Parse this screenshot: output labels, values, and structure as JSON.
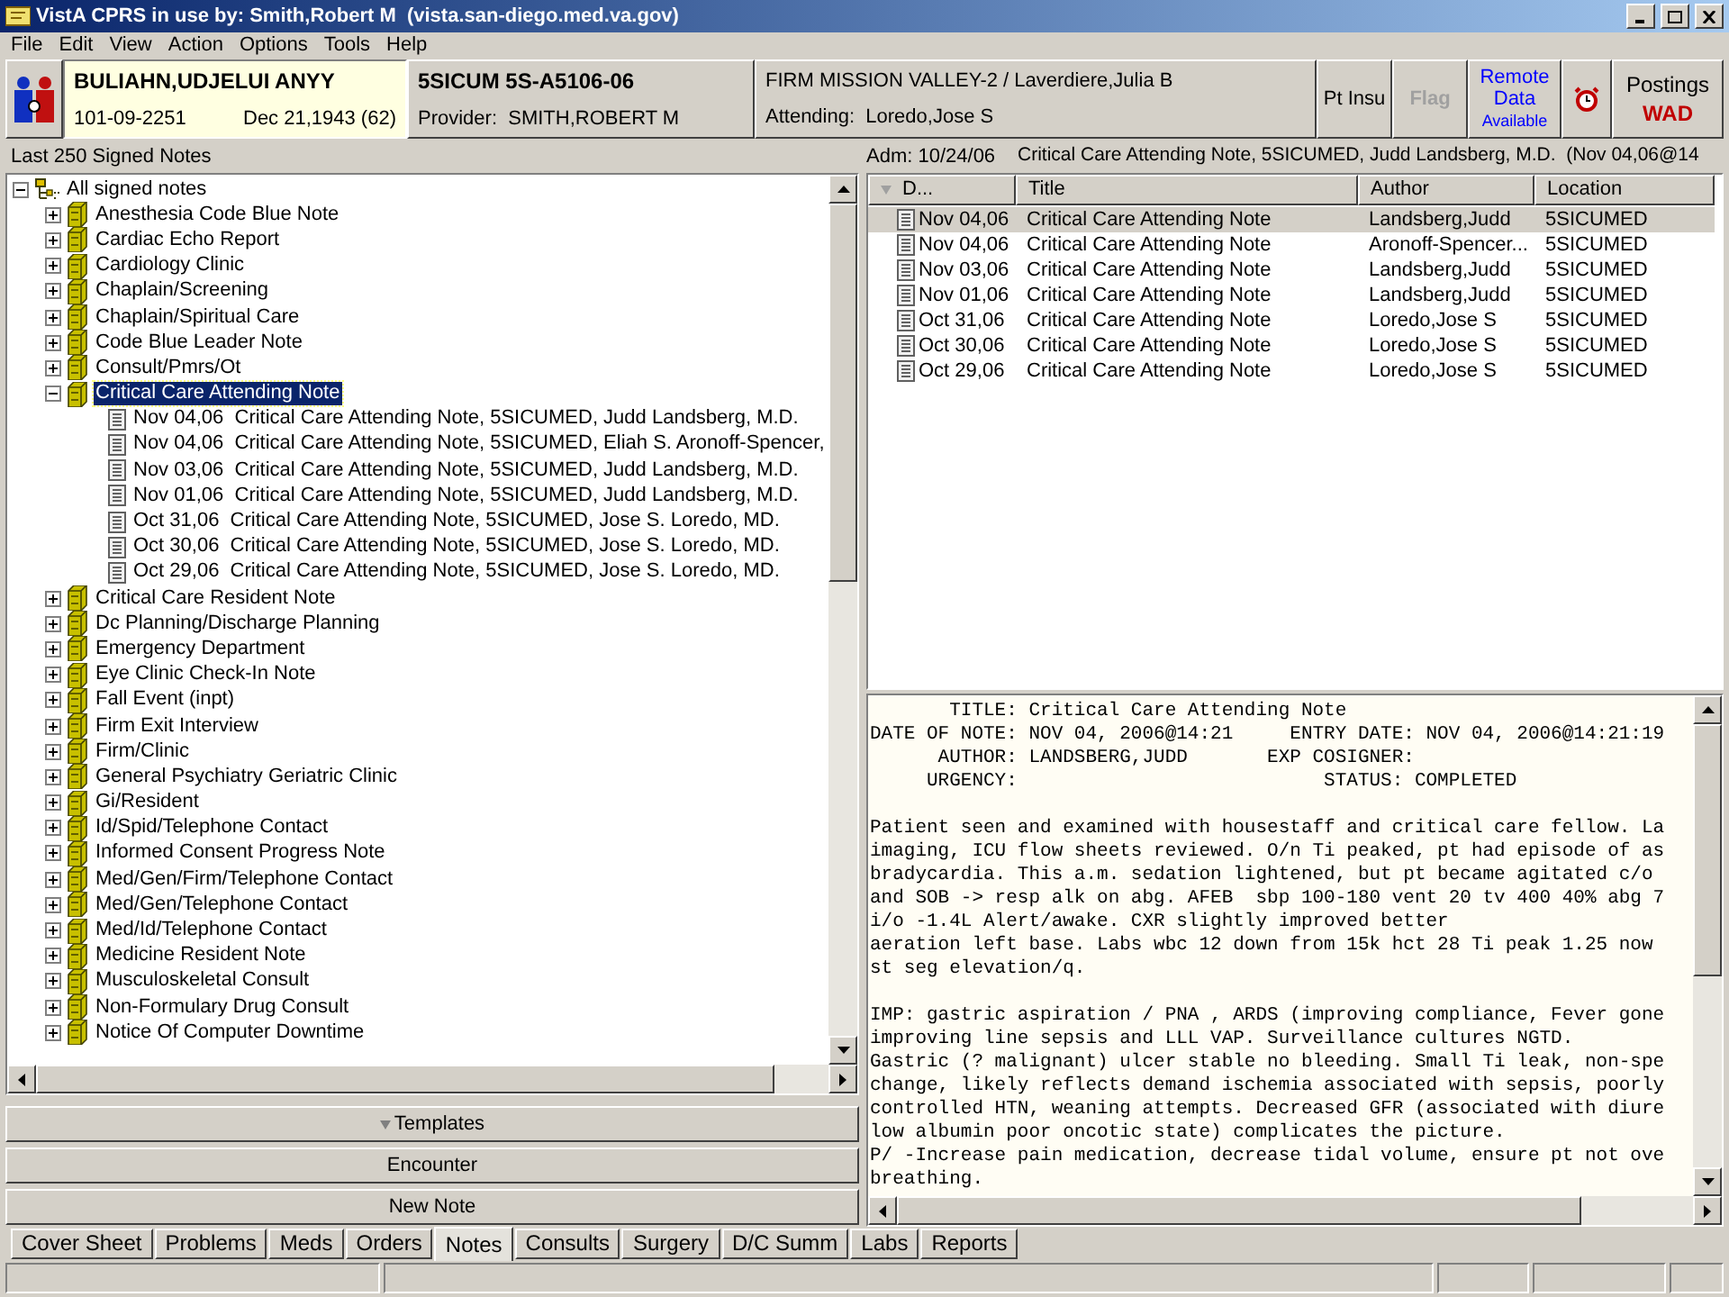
{
  "window": {
    "title": "VistA CPRS in use by: Smith,Robert M  (vista.san-diego.med.va.gov)"
  },
  "menu": [
    "File",
    "Edit",
    "View",
    "Action",
    "Options",
    "Tools",
    "Help"
  ],
  "patient": {
    "name": "BULIAHN,UDJELUI ANYY",
    "ssn": "101-09-2251",
    "dob": "Dec 21,1943 (62)"
  },
  "location": {
    "ward": "5SICUM 5S-A5106-06",
    "provider": "Provider:  SMITH,ROBERT M"
  },
  "team": {
    "firm": "FIRM MISSION VALLEY-2 / Laverdiere,Julia B",
    "attending": "Attending:  Loredo,Jose S"
  },
  "header_buttons": [
    {
      "kind": "text",
      "label": "Pt Insu",
      "disabled": false
    },
    {
      "kind": "text",
      "label": "Flag",
      "disabled": true
    },
    {
      "kind": "remote",
      "lines": [
        "Remote",
        "Data",
        "Available"
      ]
    },
    {
      "kind": "alarm"
    },
    {
      "kind": "postings",
      "label": "Postings",
      "value": "WAD"
    }
  ],
  "left_caption": "Last 250 Signed Notes",
  "right_caption": {
    "admission": "Adm: 10/24/06",
    "note": "Critical Care Attending Note, 5SICUMED, Judd Landsberg, M.D.  (Nov 04,06@14"
  },
  "tree": {
    "kind": "root",
    "label": "All signed notes",
    "expanded": true,
    "selected": false,
    "children": [
      {
        "kind": "category",
        "label": "Anesthesia Code Blue Note",
        "expanded": false,
        "selected": false
      },
      {
        "kind": "category",
        "label": "Cardiac Echo Report",
        "expanded": false,
        "selected": false
      },
      {
        "kind": "category",
        "label": "Cardiology Clinic",
        "expanded": false,
        "selected": false
      },
      {
        "kind": "category",
        "label": "Chaplain/Screening",
        "expanded": false,
        "selected": false
      },
      {
        "kind": "category",
        "label": "Chaplain/Spiritual Care",
        "expanded": false,
        "selected": false
      },
      {
        "kind": "category",
        "label": "Code Blue Leader Note",
        "expanded": false,
        "selected": false
      },
      {
        "kind": "category",
        "label": "Consult/Pmrs/Ot",
        "expanded": false,
        "selected": false
      },
      {
        "kind": "category",
        "label": "Critical Care Attending Note",
        "expanded": true,
        "selected": true,
        "children": [
          {
            "kind": "note",
            "label": "Nov 04,06  Critical Care Attending Note, 5SICUMED, Judd Landsberg, M.D.",
            "selected": false
          },
          {
            "kind": "note",
            "label": "Nov 04,06  Critical Care Attending Note, 5SICUMED, Eliah S. Aronoff-Spencer,",
            "selected": false
          },
          {
            "kind": "note",
            "label": "Nov 03,06  Critical Care Attending Note, 5SICUMED, Judd Landsberg, M.D.",
            "selected": false
          },
          {
            "kind": "note",
            "label": "Nov 01,06  Critical Care Attending Note, 5SICUMED, Judd Landsberg, M.D.",
            "selected": false
          },
          {
            "kind": "note",
            "label": "Oct 31,06  Critical Care Attending Note, 5SICUMED, Jose S. Loredo, MD.",
            "selected": false
          },
          {
            "kind": "note",
            "label": "Oct 30,06  Critical Care Attending Note, 5SICUMED, Jose S. Loredo, MD.",
            "selected": false
          },
          {
            "kind": "note",
            "label": "Oct 29,06  Critical Care Attending Note, 5SICUMED, Jose S. Loredo, MD.",
            "selected": false
          }
        ]
      },
      {
        "kind": "category",
        "label": "Critical Care Resident Note",
        "expanded": false,
        "selected": false
      },
      {
        "kind": "category",
        "label": "Dc Planning/Discharge Planning",
        "expanded": false,
        "selected": false
      },
      {
        "kind": "category",
        "label": "Emergency Department",
        "expanded": false,
        "selected": false
      },
      {
        "kind": "category",
        "label": "Eye Clinic Check-In Note",
        "expanded": false,
        "selected": false
      },
      {
        "kind": "category",
        "label": "Fall Event (inpt)",
        "expanded": false,
        "selected": false
      },
      {
        "kind": "category",
        "label": "Firm Exit Interview",
        "expanded": false,
        "selected": false
      },
      {
        "kind": "category",
        "label": "Firm/Clinic",
        "expanded": false,
        "selected": false
      },
      {
        "kind": "category",
        "label": "General Psychiatry Geriatric Clinic",
        "expanded": false,
        "selected": false
      },
      {
        "kind": "category",
        "label": "Gi/Resident",
        "expanded": false,
        "selected": false
      },
      {
        "kind": "category",
        "label": "Id/Spid/Telephone Contact",
        "expanded": false,
        "selected": false
      },
      {
        "kind": "category",
        "label": "Informed Consent Progress Note",
        "expanded": false,
        "selected": false
      },
      {
        "kind": "category",
        "label": "Med/Gen/Firm/Telephone Contact",
        "expanded": false,
        "selected": false
      },
      {
        "kind": "category",
        "label": "Med/Gen/Telephone Contact",
        "expanded": false,
        "selected": false
      },
      {
        "kind": "category",
        "label": "Med/Id/Telephone Contact",
        "expanded": false,
        "selected": false
      },
      {
        "kind": "category",
        "label": "Medicine Resident Note",
        "expanded": false,
        "selected": false
      },
      {
        "kind": "category",
        "label": "Musculoskeletal Consult",
        "expanded": false,
        "selected": false
      },
      {
        "kind": "category",
        "label": "Non-Formulary Drug Consult",
        "expanded": false,
        "selected": false
      },
      {
        "kind": "category",
        "label": "Notice Of Computer Downtime",
        "expanded": false,
        "selected": false
      }
    ]
  },
  "action_buttons": [
    {
      "kind": "dropdown",
      "label": "Templates"
    },
    {
      "kind": "plain",
      "label": "Encounter"
    },
    {
      "kind": "plain",
      "label": "New Note"
    }
  ],
  "table": {
    "columns": [
      "D...",
      "Title",
      "Author",
      "Location"
    ],
    "rows": [
      {
        "date": "Nov 04,06",
        "title": "Critical Care Attending Note",
        "author": "Landsberg,Judd",
        "location": "5SICUMED",
        "selected": true
      },
      {
        "date": "Nov 04,06",
        "title": "Critical Care Attending Note",
        "author": "Aronoff-Spencer...",
        "location": "5SICUMED",
        "selected": false
      },
      {
        "date": "Nov 03,06",
        "title": "Critical Care Attending Note",
        "author": "Landsberg,Judd",
        "location": "5SICUMED",
        "selected": false
      },
      {
        "date": "Nov 01,06",
        "title": "Critical Care Attending Note",
        "author": "Landsberg,Judd",
        "location": "5SICUMED",
        "selected": false
      },
      {
        "date": "Oct 31,06",
        "title": "Critical Care Attending Note",
        "author": "Loredo,Jose S",
        "location": "5SICUMED",
        "selected": false
      },
      {
        "date": "Oct 30,06",
        "title": "Critical Care Attending Note",
        "author": "Loredo,Jose S",
        "location": "5SICUMED",
        "selected": false
      },
      {
        "date": "Oct 29,06",
        "title": "Critical Care Attending Note",
        "author": "Loredo,Jose S",
        "location": "5SICUMED",
        "selected": false
      }
    ]
  },
  "note_text": {
    "header": [
      "       TITLE: Critical Care Attending Note",
      "DATE OF NOTE: NOV 04, 2006@14:21     ENTRY DATE: NOV 04, 2006@14:21:19",
      "      AUTHOR: LANDSBERG,JUDD       EXP COSIGNER:",
      "     URGENCY:                           STATUS: COMPLETED"
    ],
    "paragraphs": [
      [
        "Patient seen and examined with housestaff and critical care fellow. La",
        "imaging, ICU flow sheets reviewed. O/n Ti peaked, pt had episode of as",
        "bradycardia. This a.m. sedation lightened, but pt became agitated c/o",
        "and SOB -> resp alk on abg. AFEB  sbp 100-180 vent 20 tv 400 40% abg 7",
        "i/o -1.4L Alert/awake. CXR slightly improved better",
        "aeration left base. Labs wbc 12 down from 15k hct 28 Ti peak 1.25 now",
        "st seg elevation/q."
      ],
      [
        "IMP: gastric aspiration / PNA , ARDS (improving compliance, Fever gone",
        "improving line sepsis and LLL VAP. Surveillance cultures NGTD.",
        "Gastric (? malignant) ulcer stable no bleeding. Small Ti leak, non-spe",
        "change, likely reflects demand ischemia associated with sepsis, poorly",
        "controlled HTN, weaning attempts. Decreased GFR (associated with diure",
        "low albumin poor oncotic state) complicates the picture.",
        "P/ -Increase pain medication, decrease tidal volume, ensure pt not ove",
        "breathing."
      ]
    ]
  },
  "tabs": [
    {
      "label": "Cover Sheet",
      "selected": false
    },
    {
      "label": "Problems",
      "selected": false
    },
    {
      "label": "Meds",
      "selected": false
    },
    {
      "label": "Orders",
      "selected": false
    },
    {
      "label": "Notes",
      "selected": true
    },
    {
      "label": "Consults",
      "selected": false
    },
    {
      "label": "Surgery",
      "selected": false
    },
    {
      "label": "D/C Summ",
      "selected": false
    },
    {
      "label": "Labs",
      "selected": false
    },
    {
      "label": "Reports",
      "selected": false
    }
  ]
}
